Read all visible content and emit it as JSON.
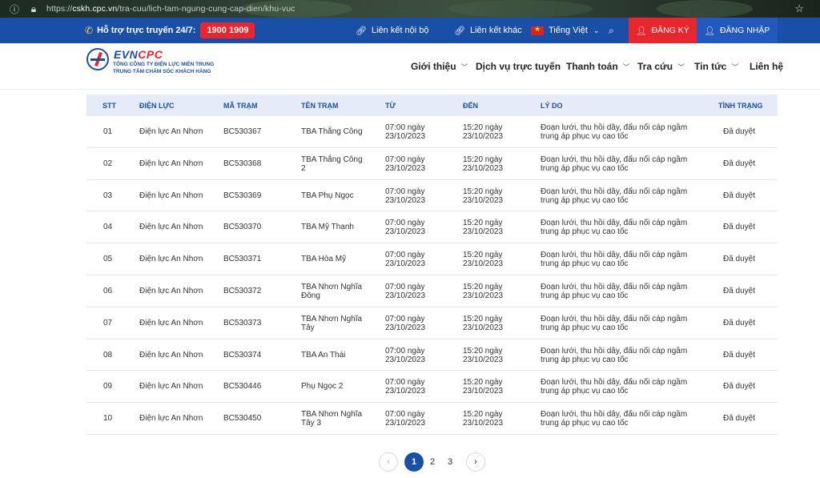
{
  "browser": {
    "url_prefix": "https://",
    "url_host": "cskh.cpc.vn",
    "url_path": "/tra-cuu/lich-tam-ngung-cung-cap-dien/khu-vuc"
  },
  "topbar": {
    "hotline_label": "Hỗ trợ trực truyến 24/7:",
    "hotline_number": "1900 1909",
    "internal_link": "Liên kết nội bộ",
    "other_link": "Liên kết khác",
    "language": "Tiếng Việt",
    "register": "ĐĂNG KÝ",
    "login": "ĐĂNG NHẬP"
  },
  "logo": {
    "brand_evn": "EVN",
    "brand_cpc": "CPC",
    "line1": "TỔNG CÔNG TY ĐIỆN LỰC MIỀN TRUNG",
    "line2": "TRUNG TÂM CHĂM SÓC KHÁCH HÀNG"
  },
  "nav": {
    "intro": "Giới thiệu",
    "online_services": "Dịch vụ trực tuyến",
    "payment": "Thanh toán",
    "lookup": "Tra cứu",
    "news": "Tin tức",
    "contact": "Liên hệ"
  },
  "table": {
    "headers": [
      "STT",
      "ĐIỆN LỰC",
      "MÃ TRẠM",
      "TÊN TRẠM",
      "TỪ",
      "ĐẾN",
      "LÝ DO",
      "TÌNH TRẠNG"
    ],
    "rows": [
      {
        "stt": "01",
        "dienluc": "Điện lực An Nhơn",
        "ma": "BC530367",
        "ten1": "TBA Thắng Công",
        "ten2": "",
        "tu1": "07:00 ngày",
        "tu2": "23/10/2023",
        "den1": "15:20 ngày",
        "den2": "23/10/2023",
        "lydo1": "Đoạn lưới, thu hồi dây, đấu nối cáp ngầm",
        "lydo2": "trung áp phục vụ cao tốc",
        "status": "Đã duyệt"
      },
      {
        "stt": "02",
        "dienluc": "Điện lực An Nhơn",
        "ma": "BC530368",
        "ten1": "TBA Thắng Công",
        "ten2": "2",
        "tu1": "07:00 ngày",
        "tu2": "23/10/2023",
        "den1": "15:20 ngày",
        "den2": "23/10/2023",
        "lydo1": "Đoạn lưới, thu hồi dây, đấu nối cáp ngầm",
        "lydo2": "trung áp phục vụ cao tốc",
        "status": "Đã duyệt"
      },
      {
        "stt": "03",
        "dienluc": "Điện lực An Nhơn",
        "ma": "BC530369",
        "ten1": "TBA Phụ Ngọc",
        "ten2": "",
        "tu1": "07:00 ngày",
        "tu2": "23/10/2023",
        "den1": "15:20 ngày",
        "den2": "23/10/2023",
        "lydo1": "Đoạn lưới, thu hồi dây, đấu nối cáp ngầm",
        "lydo2": "trung áp phục vụ cao tốc",
        "status": "Đã duyệt"
      },
      {
        "stt": "04",
        "dienluc": "Điện lực An Nhơn",
        "ma": "BC530370",
        "ten1": "TBA Mỹ Thạnh",
        "ten2": "",
        "tu1": "07:00 ngày",
        "tu2": "23/10/2023",
        "den1": "15:20 ngày",
        "den2": "23/10/2023",
        "lydo1": "Đoạn lưới, thu hồi dây, đấu nối cáp ngầm",
        "lydo2": "trung áp phục vụ cao tốc",
        "status": "Đã duyệt"
      },
      {
        "stt": "05",
        "dienluc": "Điện lực An Nhơn",
        "ma": "BC530371",
        "ten1": "TBA Hòa Mỹ",
        "ten2": "",
        "tu1": "07:00 ngày",
        "tu2": "23/10/2023",
        "den1": "15:20 ngày",
        "den2": "23/10/2023",
        "lydo1": "Đoạn lưới, thu hồi dây, đấu nối cáp ngầm",
        "lydo2": "trung áp phục vụ cao tốc",
        "status": "Đã duyệt"
      },
      {
        "stt": "06",
        "dienluc": "Điện lực An Nhơn",
        "ma": "BC530372",
        "ten1": "TBA Nhơn Nghĩa",
        "ten2": "Đông",
        "tu1": "07:00 ngày",
        "tu2": "23/10/2023",
        "den1": "15:20 ngày",
        "den2": "23/10/2023",
        "lydo1": "Đoạn lưới, thu hồi dây, đấu nối cáp ngầm",
        "lydo2": "trung áp phục vụ cao tốc",
        "status": "Đã duyệt"
      },
      {
        "stt": "07",
        "dienluc": "Điện lực An Nhơn",
        "ma": "BC530373",
        "ten1": "TBA Nhơn Nghĩa",
        "ten2": "Tây",
        "tu1": "07:00 ngày",
        "tu2": "23/10/2023",
        "den1": "15:20 ngày",
        "den2": "23/10/2023",
        "lydo1": "Đoạn lưới, thu hồi dây, đấu nối cáp ngầm",
        "lydo2": "trung áp phục vụ cao tốc",
        "status": "Đã duyệt"
      },
      {
        "stt": "08",
        "dienluc": "Điện lực An Nhơn",
        "ma": "BC530374",
        "ten1": "TBA An Thái",
        "ten2": "",
        "tu1": "07:00 ngày",
        "tu2": "23/10/2023",
        "den1": "15:20 ngày",
        "den2": "23/10/2023",
        "lydo1": "Đoạn lưới, thu hồi dây, đấu nối cáp ngầm",
        "lydo2": "trung áp phục vụ cao tốc",
        "status": "Đã duyệt"
      },
      {
        "stt": "09",
        "dienluc": "Điện lực An Nhơn",
        "ma": "BC530446",
        "ten1": "Phụ Ngọc 2",
        "ten2": "",
        "tu1": "07:00 ngày",
        "tu2": "23/10/2023",
        "den1": "15:20 ngày",
        "den2": "23/10/2023",
        "lydo1": "Đoạn lưới, thu hồi dây, đấu nối cáp ngầm",
        "lydo2": "trung áp phục vụ cao tốc",
        "status": "Đã duyệt"
      },
      {
        "stt": "10",
        "dienluc": "Điện lực An Nhơn",
        "ma": "BC530450",
        "ten1": "TBA Nhơn Nghĩa",
        "ten2": "Tây 3",
        "tu1": "07:00 ngày",
        "tu2": "23/10/2023",
        "den1": "15:20 ngày",
        "den2": "23/10/2023",
        "lydo1": "Đoạn lưới, thu hồi dây, đấu nối cáp ngầm",
        "lydo2": "trung áp phục vụ cao tốc",
        "status": "Đã duyệt"
      }
    ]
  },
  "pagination": {
    "prev": "‹",
    "pages": [
      "1",
      "2",
      "3"
    ],
    "current": "1",
    "next": "›"
  },
  "colors": {
    "primary": "#1a4fa8",
    "accent_red": "#e8262d",
    "header_bg": "#e6ecf7"
  }
}
